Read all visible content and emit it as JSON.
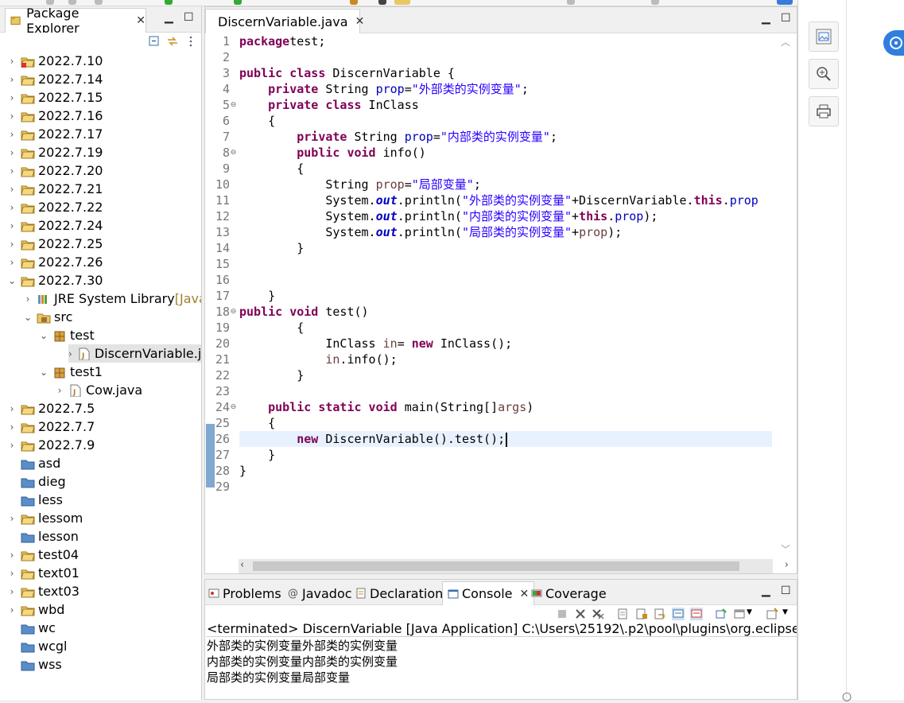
{
  "package_explorer": {
    "title": "Package Explorer",
    "tree": [
      {
        "label": "2022.7.10",
        "expanded": false,
        "icon": "project-error-icon"
      },
      {
        "label": "2022.7.14",
        "expanded": false,
        "icon": "project-icon"
      },
      {
        "label": "2022.7.15",
        "expanded": false,
        "icon": "project-icon"
      },
      {
        "label": "2022.7.16",
        "expanded": false,
        "icon": "project-icon"
      },
      {
        "label": "2022.7.17",
        "expanded": false,
        "icon": "project-icon"
      },
      {
        "label": "2022.7.19",
        "expanded": false,
        "icon": "project-icon"
      },
      {
        "label": "2022.7.20",
        "expanded": false,
        "icon": "project-icon"
      },
      {
        "label": "2022.7.21",
        "expanded": false,
        "icon": "project-icon"
      },
      {
        "label": "2022.7.22",
        "expanded": false,
        "icon": "project-icon"
      },
      {
        "label": "2022.7.24",
        "expanded": false,
        "icon": "project-icon"
      },
      {
        "label": "2022.7.25",
        "expanded": false,
        "icon": "project-icon"
      },
      {
        "label": "2022.7.26",
        "expanded": false,
        "icon": "project-icon"
      },
      {
        "label": "2022.7.30",
        "expanded": true,
        "icon": "project-icon"
      },
      {
        "label": "JRE System Library",
        "decoration": "[JavaS",
        "expanded": false,
        "icon": "library-icon"
      },
      {
        "label": "src",
        "expanded": true,
        "icon": "source-folder-icon"
      },
      {
        "label": "test",
        "expanded": true,
        "icon": "package-icon"
      },
      {
        "label": "DiscernVariable.java",
        "expanded": false,
        "icon": "java-file-icon",
        "selected": true
      },
      {
        "label": "test1",
        "expanded": true,
        "icon": "package-icon"
      },
      {
        "label": "Cow.java",
        "expanded": false,
        "icon": "java-file-icon"
      },
      {
        "label": "2022.7.5",
        "expanded": false,
        "icon": "project-icon"
      },
      {
        "label": "2022.7.7",
        "expanded": false,
        "icon": "project-icon"
      },
      {
        "label": "2022.7.9",
        "expanded": false,
        "icon": "project-icon"
      },
      {
        "label": "asd",
        "expanded": false,
        "icon": "closed-project-icon"
      },
      {
        "label": "dieg",
        "expanded": false,
        "icon": "closed-project-icon"
      },
      {
        "label": "less",
        "expanded": false,
        "icon": "closed-project-icon"
      },
      {
        "label": "lessom",
        "expanded": false,
        "icon": "project-icon"
      },
      {
        "label": "lesson",
        "expanded": false,
        "icon": "closed-project-icon"
      },
      {
        "label": "test04",
        "expanded": false,
        "icon": "project-icon"
      },
      {
        "label": "text01",
        "expanded": false,
        "icon": "project-icon"
      },
      {
        "label": "text03",
        "expanded": false,
        "icon": "project-icon"
      },
      {
        "label": "wbd",
        "expanded": false,
        "icon": "project-icon"
      },
      {
        "label": "wc",
        "expanded": false,
        "icon": "closed-project-icon"
      },
      {
        "label": "wcgl",
        "expanded": false,
        "icon": "closed-project-icon"
      },
      {
        "label": "wss",
        "expanded": false,
        "icon": "closed-project-icon"
      }
    ]
  },
  "editor": {
    "tab_title": "DiscernVariable.java",
    "line_numbers": [
      "1",
      "2",
      "3",
      "4",
      "5",
      "6",
      "7",
      "8",
      "9",
      "10",
      "11",
      "12",
      "13",
      "14",
      "15",
      "16",
      "17",
      "18",
      "19",
      "20",
      "21",
      "22",
      "23",
      "24",
      "25",
      "26",
      "27",
      "28",
      "29"
    ],
    "current_line": 26,
    "code": [
      [
        [
          "kw",
          "package"
        ],
        [
          "",
          "test;"
        ]
      ],
      [],
      [
        [
          "kw",
          "public class"
        ],
        [
          "",
          " DiscernVariable {"
        ]
      ],
      [
        [
          "",
          "    "
        ],
        [
          "kw",
          "private"
        ],
        [
          "",
          " String "
        ],
        [
          "fld",
          "prop"
        ],
        [
          "",
          "="
        ],
        [
          "str",
          "\"外部类的实例变量\""
        ],
        [
          "",
          ";"
        ]
      ],
      [
        [
          "",
          "    "
        ],
        [
          "kw",
          "private class"
        ],
        [
          "",
          " InClass"
        ]
      ],
      [
        [
          "",
          "    {"
        ]
      ],
      [
        [
          "",
          "        "
        ],
        [
          "kw",
          "private"
        ],
        [
          "",
          " String "
        ],
        [
          "fld",
          "prop"
        ],
        [
          "",
          "="
        ],
        [
          "str",
          "\"内部类的实例变量\""
        ],
        [
          "",
          ";"
        ]
      ],
      [
        [
          "",
          "        "
        ],
        [
          "kw",
          "public void"
        ],
        [
          "",
          " info()"
        ]
      ],
      [
        [
          "",
          "        {"
        ]
      ],
      [
        [
          "",
          "            String "
        ],
        [
          "lv",
          "prop"
        ],
        [
          "",
          "="
        ],
        [
          "str",
          "\"局部变量\""
        ],
        [
          "",
          ";"
        ]
      ],
      [
        [
          "",
          "            System."
        ],
        [
          "st",
          "out"
        ],
        [
          "",
          ".println("
        ],
        [
          "str",
          "\"外部类的实例变量\""
        ],
        [
          "",
          "+DiscernVariable."
        ],
        [
          "kw",
          "this"
        ],
        [
          "",
          "."
        ],
        [
          "fld",
          "prop"
        ]
      ],
      [
        [
          "",
          "            System."
        ],
        [
          "st",
          "out"
        ],
        [
          "",
          ".println("
        ],
        [
          "str",
          "\"内部类的实例变量\""
        ],
        [
          "",
          "+"
        ],
        [
          "kw",
          "this"
        ],
        [
          "",
          "."
        ],
        [
          "fld",
          "prop"
        ],
        [
          "",
          ");"
        ]
      ],
      [
        [
          "",
          "            System."
        ],
        [
          "st",
          "out"
        ],
        [
          "",
          ".println("
        ],
        [
          "str",
          "\"局部类的实例变量\""
        ],
        [
          "",
          "+"
        ],
        [
          "lv",
          "prop"
        ],
        [
          "",
          ");"
        ]
      ],
      [
        [
          "",
          "        }"
        ]
      ],
      [],
      [],
      [
        [
          "",
          "    }"
        ]
      ],
      [
        [
          "kw",
          "public void"
        ],
        [
          "",
          " test()"
        ]
      ],
      [
        [
          "",
          "        {"
        ]
      ],
      [
        [
          "",
          "            InClass "
        ],
        [
          "lv",
          "in"
        ],
        [
          "",
          "= "
        ],
        [
          "kw",
          "new"
        ],
        [
          "",
          " InClass();"
        ]
      ],
      [
        [
          "",
          "            "
        ],
        [
          "lv",
          "in"
        ],
        [
          "",
          ".info();"
        ]
      ],
      [
        [
          "",
          "        }"
        ]
      ],
      [],
      [
        [
          "",
          "    "
        ],
        [
          "kw",
          "public static void"
        ],
        [
          "",
          " main(String[]"
        ],
        [
          "lv",
          "args"
        ],
        [
          "",
          ")"
        ]
      ],
      [
        [
          "",
          "    {"
        ]
      ],
      [
        [
          "",
          "        "
        ],
        [
          "kw",
          "new"
        ],
        [
          "",
          " DiscernVariable().test();"
        ]
      ],
      [
        [
          "",
          "    }"
        ]
      ],
      [
        [
          "",
          "}"
        ]
      ],
      []
    ]
  },
  "bottom_panel": {
    "tabs": [
      {
        "label": "Problems",
        "icon": "problems-icon"
      },
      {
        "label": "Javadoc",
        "icon": "javadoc-icon"
      },
      {
        "label": "Declaration",
        "icon": "declaration-icon"
      },
      {
        "label": "Console",
        "icon": "console-icon",
        "active": true
      },
      {
        "label": "Coverage",
        "icon": "coverage-icon"
      }
    ],
    "console_header": "<terminated> DiscernVariable [Java Application] C:\\Users\\25192\\.p2\\pool\\plugins\\org.eclipse.justj.ope",
    "output": [
      "外部类的实例变量外部类的实例变量",
      "内部类的实例变量内部类的实例变量",
      "局部类的实例变量局部变量"
    ]
  },
  "colors": {
    "keyword": "#7f0055",
    "string": "#2a00ff",
    "field": "#0000c0",
    "current_line": "#e8f2fe",
    "selection": "#e3e3e3"
  }
}
